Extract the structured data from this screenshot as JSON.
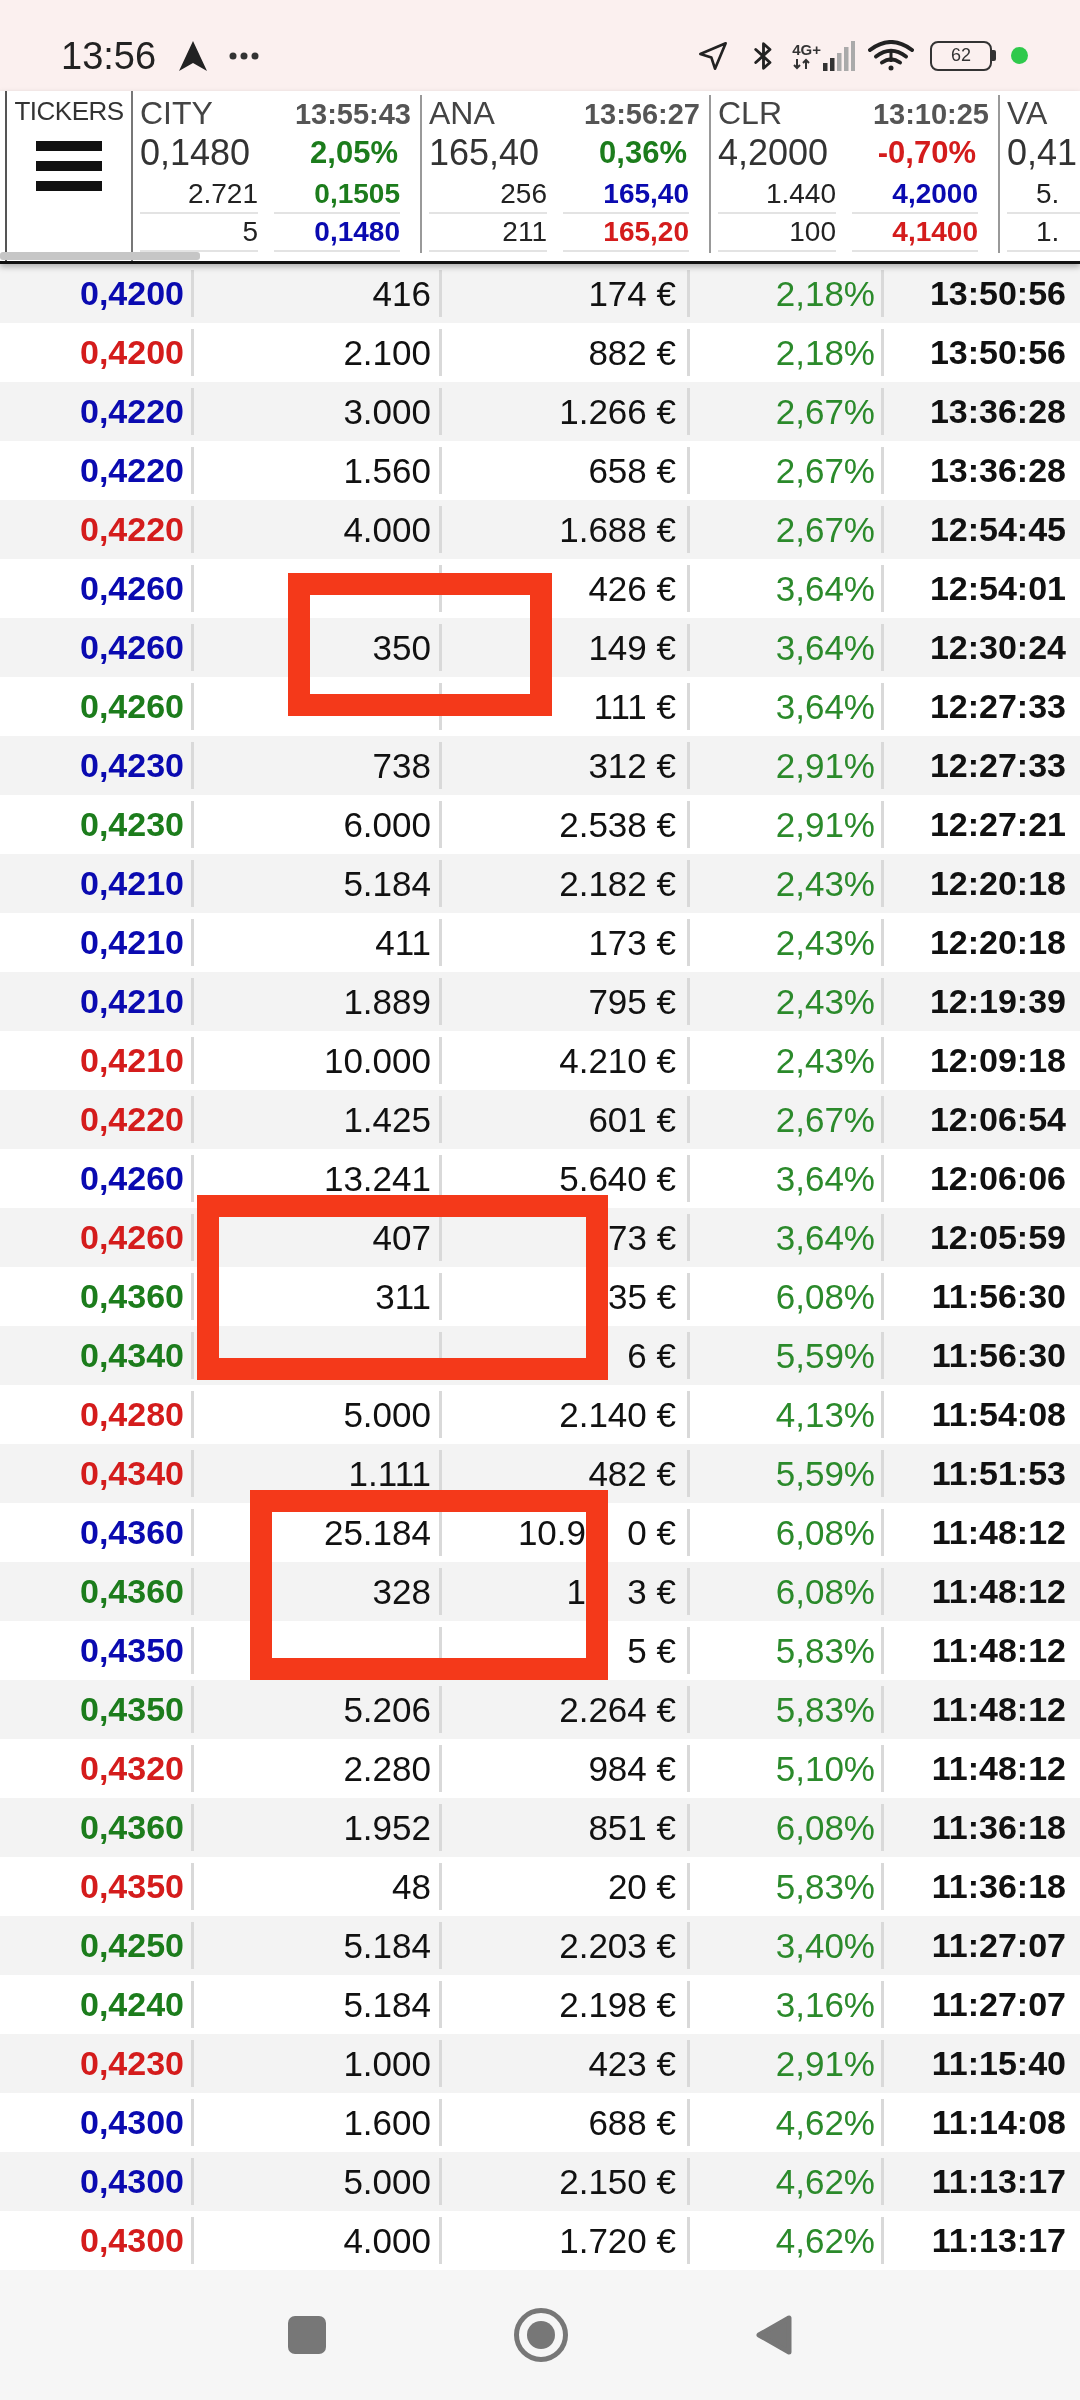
{
  "status_bar": {
    "time": "13:56",
    "network": "4G+",
    "battery": "62"
  },
  "tickers": {
    "label": "TICKERS",
    "cards": [
      {
        "symbol": "CITY",
        "time": "13:55:43",
        "price": "0,1480",
        "change": {
          "value": "2,05%",
          "color": "#1c7c1c"
        },
        "quotes": [
          {
            "volume": "2.721",
            "price": "0,1505",
            "color": "#1c7c1c"
          },
          {
            "volume": "5",
            "price": "0,1480",
            "color": "#0a0ab0"
          }
        ]
      },
      {
        "symbol": "ANA",
        "time": "13:56:27",
        "price": "165,40",
        "change": {
          "value": "0,36%",
          "color": "#1c7c1c"
        },
        "quotes": [
          {
            "volume": "256",
            "price": "165,40",
            "color": "#0a0ab0"
          },
          {
            "volume": "211",
            "price": "165,20",
            "color": "#d41c1c"
          }
        ]
      },
      {
        "symbol": "CLR",
        "time": "13:10:25",
        "price": "4,2000",
        "change": {
          "value": "-0,70%",
          "color": "#d41c1c"
        },
        "quotes": [
          {
            "volume": "1.440",
            "price": "4,2000",
            "color": "#0a0ab0"
          },
          {
            "volume": "100",
            "price": "4,1400",
            "color": "#d41c1c"
          }
        ]
      },
      {
        "symbol": "VA",
        "price": "0,41",
        "quotes": [
          {
            "volume": "5."
          },
          {
            "volume": "1."
          }
        ]
      }
    ]
  },
  "table": {
    "rows": [
      {
        "color": "#0a0ab0",
        "column_1": "0,4200",
        "column_2": "416",
        "column_3": "174 €",
        "column_4": "2,18%",
        "column_5": "13:50:56"
      },
      {
        "color": "#d41c1c",
        "column_1": "0,4200",
        "column_2": "2.100",
        "column_3": "882 €",
        "column_4": "2,18%",
        "column_5": "13:50:56"
      },
      {
        "color": "#0a0ab0",
        "column_1": "0,4220",
        "column_2": "3.000",
        "column_3": "1.266 €",
        "column_4": "2,67%",
        "column_5": "13:36:28"
      },
      {
        "color": "#0a0ab0",
        "column_1": "0,4220",
        "column_2": "1.560",
        "column_3": "658 €",
        "column_4": "2,67%",
        "column_5": "13:36:28"
      },
      {
        "color": "#d41c1c",
        "column_1": "0,4220",
        "column_2": "4.000",
        "column_3": "1.688 €",
        "column_4": "2,67%",
        "column_5": "12:54:45"
      },
      {
        "color": "#0a0ab0",
        "column_1": "0,4260",
        "column_3": "426 €",
        "column_4": "3,64%",
        "column_5": "12:54:01"
      },
      {
        "color": "#0a0ab0",
        "column_1": "0,4260",
        "column_2": "350",
        "column_3": "149 €",
        "column_4": "3,64%",
        "column_5": "12:30:24"
      },
      {
        "color": "#1c7c1c",
        "column_1": "0,4260",
        "column_3": "111 €",
        "column_4": "3,64%",
        "column_5": "12:27:33"
      },
      {
        "color": "#0a0ab0",
        "column_1": "0,4230",
        "column_2": "738",
        "column_3": "312 €",
        "column_4": "2,91%",
        "column_5": "12:27:33"
      },
      {
        "color": "#1c7c1c",
        "column_1": "0,4230",
        "column_2": "6.000",
        "column_3": "2.538 €",
        "column_4": "2,91%",
        "column_5": "12:27:21"
      },
      {
        "color": "#0a0ab0",
        "column_1": "0,4210",
        "column_2": "5.184",
        "column_3": "2.182 €",
        "column_4": "2,43%",
        "column_5": "12:20:18"
      },
      {
        "color": "#0a0ab0",
        "column_1": "0,4210",
        "column_2": "411",
        "column_3": "173 €",
        "column_4": "2,43%",
        "column_5": "12:20:18"
      },
      {
        "color": "#0a0ab0",
        "column_1": "0,4210",
        "column_2": "1.889",
        "column_3": "795 €",
        "column_4": "2,43%",
        "column_5": "12:19:39"
      },
      {
        "color": "#d41c1c",
        "column_1": "0,4210",
        "column_2": "10.000",
        "column_3": "4.210 €",
        "column_4": "2,43%",
        "column_5": "12:09:18"
      },
      {
        "color": "#d41c1c",
        "column_1": "0,4220",
        "column_2": "1.425",
        "column_3": "601 €",
        "column_4": "2,67%",
        "column_5": "12:06:54"
      },
      {
        "color": "#0a0ab0",
        "column_1": "0,4260",
        "column_2": "13.241",
        "column_3": "5.640 €",
        "column_4": "3,64%",
        "column_5": "12:06:06"
      },
      {
        "color": "#d41c1c",
        "column_1": "0,4260",
        "column_2": "407",
        "column_3": [
          "73 €"
        ],
        "column_4": "3,64%",
        "column_5": "12:05:59"
      },
      {
        "color": "#1c7c1c",
        "column_1": "0,4360",
        "column_2": "311",
        "column_3": [
          "35 €"
        ],
        "column_4": "6,08%",
        "column_5": "11:56:30"
      },
      {
        "color": "#1c7c1c",
        "column_1": "0,4340",
        "column_3": [
          "6 €"
        ],
        "column_4": "5,59%",
        "column_5": "11:56:30"
      },
      {
        "color": "#d41c1c",
        "column_1": "0,4280",
        "column_2": "5.000",
        "column_3": "2.140 €",
        "column_4": "4,13%",
        "column_5": "11:54:08"
      },
      {
        "color": "#d41c1c",
        "column_1": "0,4340",
        "column_2": "1.111",
        "column_3": "482 €",
        "column_4": "5,59%",
        "column_5": "11:51:53"
      },
      {
        "color": "#0a0ab0",
        "column_1": "0,4360",
        "column_2": "25.184",
        "column_3": [
          "10.9",
          "0 €"
        ],
        "column_4": "6,08%",
        "column_5": "11:48:12"
      },
      {
        "color": "#1c7c1c",
        "column_1": "0,4360",
        "column_2": "328",
        "column_3": [
          "1",
          "3 €"
        ],
        "column_4": "6,08%",
        "column_5": "11:48:12"
      },
      {
        "color": "#0a0ab0",
        "column_1": "0,4350",
        "column_3": [
          "5 €"
        ],
        "column_4": "5,83%",
        "column_5": "11:48:12"
      },
      {
        "color": "#1c7c1c",
        "column_1": "0,4350",
        "column_2": "5.206",
        "column_3": "2.264 €",
        "column_4": "5,83%",
        "column_5": "11:48:12"
      },
      {
        "color": "#d41c1c",
        "column_1": "0,4320",
        "column_2": "2.280",
        "column_3": "984 €",
        "column_4": "5,10%",
        "column_5": "11:48:12"
      },
      {
        "color": "#1c7c1c",
        "column_1": "0,4360",
        "column_2": "1.952",
        "column_3": "851 €",
        "column_4": "6,08%",
        "column_5": "11:36:18"
      },
      {
        "color": "#d41c1c",
        "column_1": "0,4350",
        "column_2": "48",
        "column_3": "20 €",
        "column_4": "5,83%",
        "column_5": "11:36:18"
      },
      {
        "color": "#1c7c1c",
        "column_1": "0,4250",
        "column_2": "5.184",
        "column_3": "2.203 €",
        "column_4": "3,40%",
        "column_5": "11:27:07"
      },
      {
        "color": "#1c7c1c",
        "column_1": "0,4240",
        "column_2": "5.184",
        "column_3": "2.198 €",
        "column_4": "3,16%",
        "column_5": "11:27:07"
      },
      {
        "color": "#d41c1c",
        "column_1": "0,4230",
        "column_2": "1.000",
        "column_3": "423 €",
        "column_4": "2,91%",
        "column_5": "11:15:40"
      },
      {
        "color": "#0a0ab0",
        "column_1": "0,4300",
        "column_2": "1.600",
        "column_3": "688 €",
        "column_4": "4,62%",
        "column_5": "11:14:08"
      },
      {
        "color": "#0a0ab0",
        "column_1": "0,4300",
        "column_2": "5.000",
        "column_3": "2.150 €",
        "column_4": "4,62%",
        "column_5": "11:13:17"
      },
      {
        "color": "#d41c1c",
        "column_1": "0,4300",
        "column_2": "4.000",
        "column_3": "1.720 €",
        "column_4": "4,62%",
        "column_5": "11:13:17"
      }
    ]
  },
  "annotations": [
    {
      "kind": "frame"
    },
    {
      "kind": "frame"
    },
    {
      "kind": "frame"
    }
  ]
}
